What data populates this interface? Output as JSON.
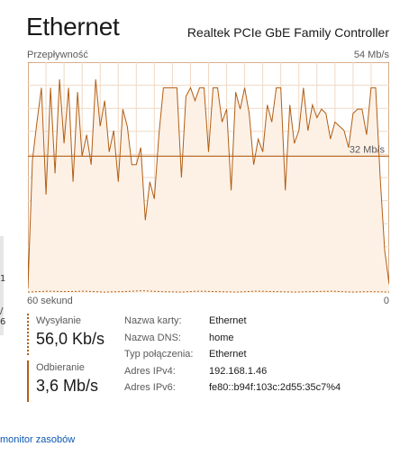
{
  "title": "Ethernet",
  "adapter_name": "Realtek PCIe GbE Family Controller",
  "graph": {
    "top_left_label": "Przepływność",
    "top_right_label": "54 Mb/s",
    "bottom_left_label": "60 sekund",
    "bottom_right_label": "0",
    "marker_label": "32 Mb/s",
    "marker_value": 32,
    "max_value": 54,
    "line_color": "#b25e14",
    "fill_color": "#fdf1e6",
    "grid_color": "#f0d9c4"
  },
  "stats": {
    "send_label": "Wysyłanie",
    "send_value": "56,0 Kb/s",
    "recv_label": "Odbieranie",
    "recv_value": "3,6 Mb/s"
  },
  "properties": [
    {
      "key": "Nazwa karty:",
      "value": "Ethernet"
    },
    {
      "key": "Nazwa DNS:",
      "value": "home"
    },
    {
      "key": "Typ połączenia:",
      "value": "Ethernet"
    },
    {
      "key": "Adres IPv4:",
      "value": "192.168.1.46"
    },
    {
      "key": "Adres IPv6:",
      "value": "fe80::b94f:103c:2d55:35c7%4"
    }
  ],
  "left_fragments": [
    "1",
    "/",
    "6"
  ],
  "footer_link": "monitor zasobów",
  "chart_data": {
    "type": "area",
    "title": "Przepływność",
    "xlabel": "60 sekund",
    "ylabel": "",
    "ylim": [
      0,
      54
    ],
    "series": [
      {
        "values": [
          1,
          31,
          40,
          48,
          23,
          48,
          28,
          50,
          35,
          48,
          26,
          47,
          32,
          37,
          30,
          50,
          39,
          45,
          33,
          38,
          26,
          43,
          39,
          30,
          30,
          34,
          17,
          26,
          22,
          37,
          48,
          48,
          48,
          48,
          27,
          46,
          48,
          45,
          48,
          48,
          33,
          48,
          48,
          40,
          43,
          24,
          47,
          43,
          48,
          42,
          30,
          36,
          33,
          44,
          40,
          48,
          48,
          24,
          44,
          35,
          38,
          48,
          38,
          44,
          41,
          43,
          42,
          36,
          40,
          39,
          38,
          34,
          42,
          43,
          43,
          37,
          48,
          48,
          27,
          10,
          2
        ]
      },
      {
        "values": [
          0.2,
          0.4,
          0.3,
          0.4,
          0.2,
          0.3,
          0.5,
          0.3,
          0.2,
          0.4,
          0.3,
          0.2,
          0.4,
          0.3,
          0.2,
          0.3,
          0.4,
          0.2,
          0.3,
          0.2
        ]
      }
    ],
    "grid": true,
    "reference_line": 32
  }
}
